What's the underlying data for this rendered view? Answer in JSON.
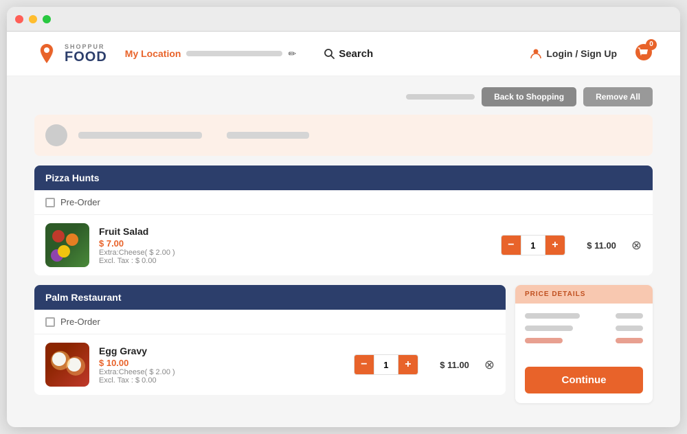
{
  "window": {
    "dots": [
      "red",
      "yellow",
      "green"
    ]
  },
  "navbar": {
    "logo_top": "SHOPPUR",
    "logo_bottom": "FOOD",
    "my_location_label": "My Location",
    "search_label": "Search",
    "login_label": "Login / Sign Up",
    "cart_count": "0"
  },
  "actions": {
    "back_to_shopping": "Back to Shopping",
    "remove_all": "Remove All"
  },
  "sections": [
    {
      "id": "pizza-hunts",
      "restaurant_name": "Pizza Hunts",
      "pre_order_label": "Pre-Order",
      "items": [
        {
          "name": "Fruit Salad",
          "price": "$ 7.00",
          "extra": "Extra:Cheese( $ 2.00 )",
          "tax": "Excl. Tax : $ 0.00",
          "qty": "1",
          "total": "$ 11.00",
          "type": "fruit-salad"
        }
      ]
    },
    {
      "id": "palm-restaurant",
      "restaurant_name": "Palm Restaurant",
      "pre_order_label": "Pre-Order",
      "items": [
        {
          "name": "Egg Gravy",
          "price": "$ 10.00",
          "extra": "Extra:Cheese( $ 2.00 )",
          "tax": "Excl. Tax : $ 0.00",
          "qty": "1",
          "total": "$ 11.00",
          "type": "egg-gravy"
        }
      ]
    }
  ],
  "price_details": {
    "header": "PRICE DETAILS",
    "continue_label": "Continue"
  }
}
